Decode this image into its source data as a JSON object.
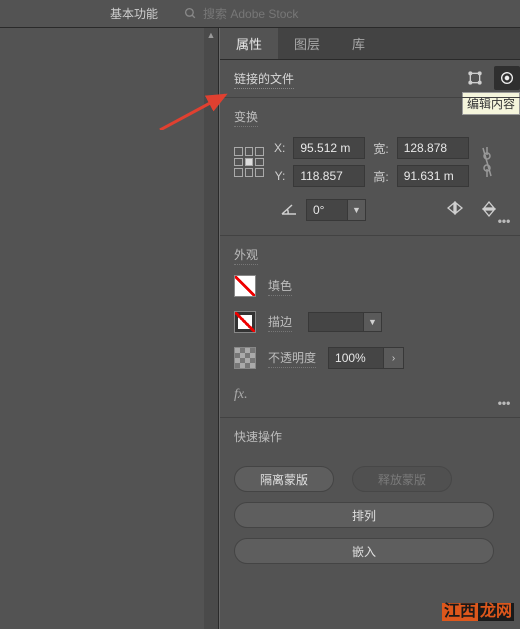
{
  "topbar": {
    "workspace_label": "基本功能",
    "search_placeholder": "搜索 Adobe Stock"
  },
  "tabs": {
    "properties": "属性",
    "layers": "图层",
    "library": "库"
  },
  "header": {
    "linked_file_label": "链接的文件",
    "tooltip": "编辑内容"
  },
  "transform": {
    "title": "变换",
    "x_label": "X:",
    "y_label": "Y:",
    "w_label": "宽:",
    "h_label": "高:",
    "x_value": "95.512 m",
    "y_value": "118.857",
    "w_value": "128.878",
    "h_value": "91.631 m",
    "rotate_value": "0°"
  },
  "appearance": {
    "title": "外观",
    "fill_label": "填色",
    "stroke_label": "描边",
    "opacity_label": "不透明度",
    "opacity_value": "100%",
    "fx_label": "fx."
  },
  "quick": {
    "title": "快速操作",
    "isolate_btn": "隔离蒙版",
    "release_btn": "释放蒙版",
    "arrange_btn": "排列",
    "embed_btn": "嵌入"
  },
  "watermark": {
    "a": "江西",
    "b": "龙网"
  }
}
